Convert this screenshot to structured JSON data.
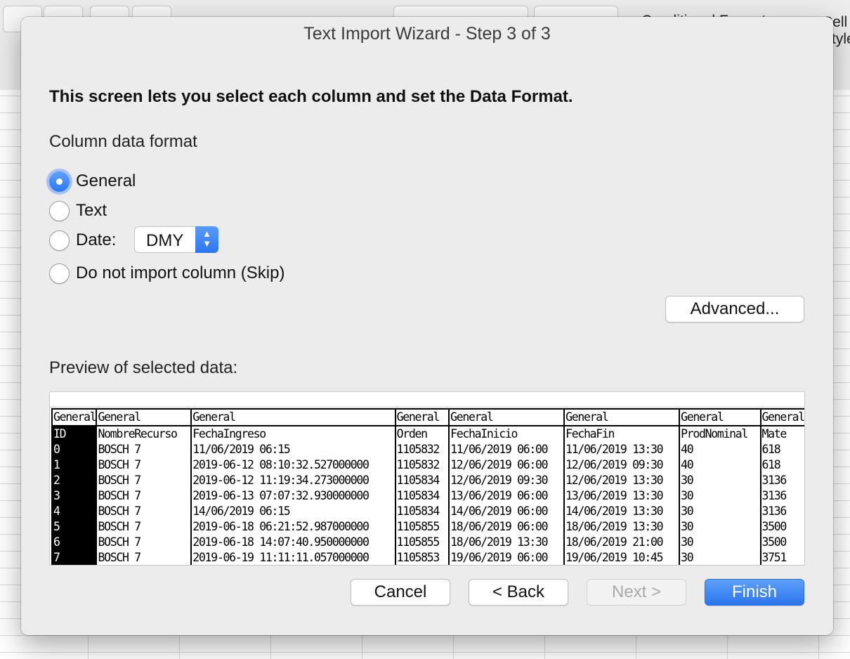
{
  "background": {
    "toolbar_fragments": [
      "Conditional Format",
      "Cell",
      "Styles"
    ]
  },
  "dialog": {
    "title": "Text Import Wizard - Step 3 of 3",
    "heading": "This screen lets you select each column and set the Data Format.",
    "column_format_label": "Column data format",
    "options": [
      {
        "label": "General",
        "selected": true
      },
      {
        "label": "Text",
        "selected": false
      },
      {
        "label": "Date:",
        "selected": false
      },
      {
        "label": "Do not import column (Skip)",
        "selected": false
      }
    ],
    "date_format": "DMY",
    "advanced_button": "Advanced...",
    "preview_label": "Preview of selected data:",
    "preview": {
      "formats": [
        "General",
        "General",
        "General",
        "General",
        "General",
        "General",
        "General",
        "General"
      ],
      "headers": [
        "ID",
        "NombreRecurso",
        "FechaIngreso",
        "Orden",
        "FechaInicio",
        "FechaFin",
        "ProdNominal",
        "Mate"
      ],
      "rows": [
        [
          "0",
          "BOSCH 7",
          "11/06/2019 06:15",
          "1105832",
          "11/06/2019 06:00",
          "11/06/2019 13:30",
          "40",
          "618"
        ],
        [
          "1",
          "BOSCH 7",
          "2019-06-12 08:10:32.527000000",
          "1105832",
          "12/06/2019 06:00",
          "12/06/2019 09:30",
          "40",
          "618"
        ],
        [
          "2",
          "BOSCH 7",
          "2019-06-12 11:19:34.273000000",
          "1105834",
          "12/06/2019 09:30",
          "12/06/2019 13:30",
          "30",
          "3136"
        ],
        [
          "3",
          "BOSCH 7",
          "2019-06-13 07:07:32.930000000",
          "1105834",
          "13/06/2019 06:00",
          "13/06/2019 13:30",
          "30",
          "3136"
        ],
        [
          "4",
          "BOSCH 7",
          "14/06/2019 06:15",
          "1105834",
          "14/06/2019 06:00",
          "14/06/2019 13:30",
          "30",
          "3136"
        ],
        [
          "5",
          "BOSCH 7",
          "2019-06-18 06:21:52.987000000",
          "1105855",
          "18/06/2019 06:00",
          "18/06/2019 13:30",
          "30",
          "3500"
        ],
        [
          "6",
          "BOSCH 7",
          "2019-06-18 14:07:40.950000000",
          "1105855",
          "18/06/2019 13:30",
          "18/06/2019 21:00",
          "30",
          "3500"
        ],
        [
          "7",
          "BOSCH 7",
          "2019-06-19 11:11:11.057000000",
          "1105853",
          "19/06/2019 06:00",
          "19/06/2019 10:45",
          "30",
          "3751"
        ]
      ]
    },
    "buttons": {
      "cancel": "Cancel",
      "back": "< Back",
      "next": "Next >",
      "finish": "Finish"
    }
  }
}
